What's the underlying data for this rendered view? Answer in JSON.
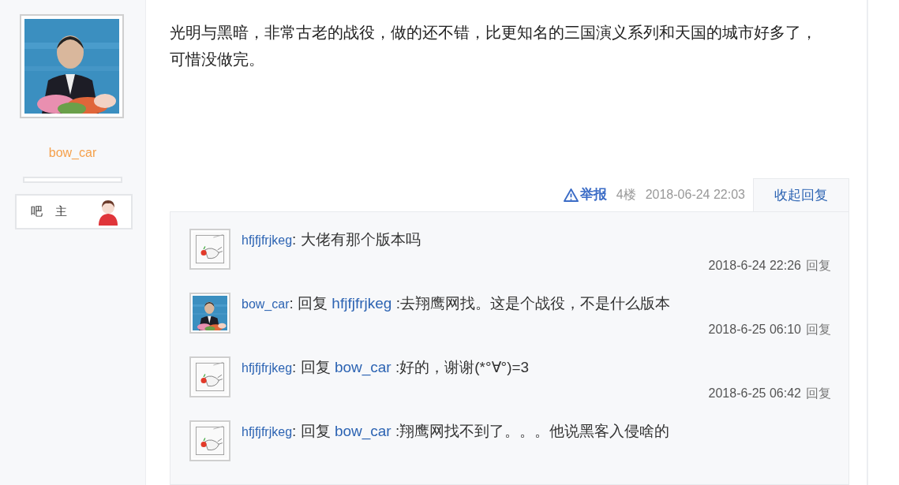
{
  "author": {
    "name": "bow_car",
    "badge": "吧 主"
  },
  "post": {
    "text": "光明与黑暗，非常古老的战役，做的还不错，比更知名的三国演义系列和天国的城市好多了，可惜没做完。"
  },
  "meta": {
    "report": "举报",
    "floor": "4楼",
    "time": "2018-06-24 22:03",
    "collapse_tab": "收起回复"
  },
  "replies": [
    {
      "author": "hfjfjfrjkeg",
      "separator": ":",
      "text": "大佬有那个版本吗",
      "time": "2018-6-24 22:26",
      "reply_button": "回复"
    },
    {
      "author": "bow_car",
      "separator": ":",
      "reply_label": "回复",
      "reply_to": "hfjfjfrjkeg",
      "text": ":去翔鹰网找。这是个战役，不是什么版本",
      "time": "2018-6-25 06:10",
      "reply_button": "回复"
    },
    {
      "author": "hfjfjfrjkeg",
      "separator": ":",
      "reply_label": "回复",
      "reply_to": "bow_car",
      "text": ":好的，谢谢(*°∀°)=3",
      "time": "2018-6-25 06:42",
      "reply_button": "回复"
    },
    {
      "author": "hfjfjfrjkeg",
      "separator": ":",
      "reply_label": "回复",
      "reply_to": "bow_car",
      "text": ":翔鹰网找不到了。。。他说黑客入侵啥的"
    }
  ]
}
